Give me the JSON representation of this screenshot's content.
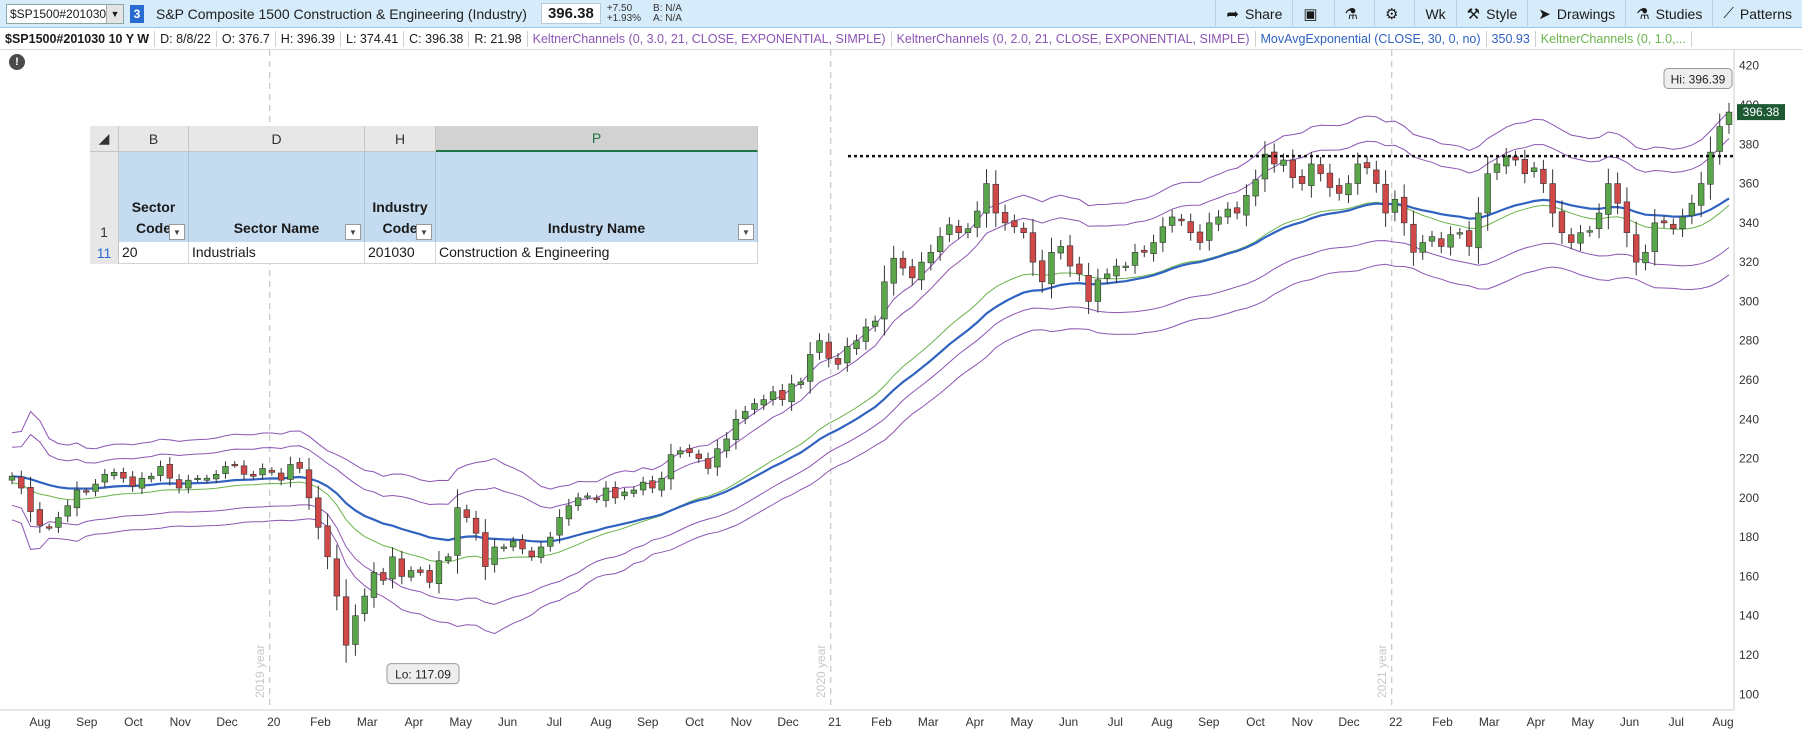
{
  "toolbar": {
    "symbol_input": "$SP1500#201030",
    "link_badge": "3",
    "security_name": "S&P Composite 1500 Construction & Engineering (Industry)",
    "last_price": "396.38",
    "change_abs": "+7.50",
    "change_pct": "+1.93%",
    "bid": "B: N/A",
    "ask": "A: N/A",
    "share_label": "Share",
    "aggregation_label": "Wk",
    "style_label": "Style",
    "drawings_label": "Drawings",
    "studies_label": "Studies",
    "patterns_label": "Patterns"
  },
  "study_bar": {
    "symbol_period": "$SP1500#201030 10 Y W",
    "date": "D: 8/8/22",
    "open": "O: 376.7",
    "high": "H: 396.39",
    "low": "L: 374.41",
    "close": "C: 396.38",
    "range": "R: 21.98",
    "study1": "KeltnerChannels (0, 3.0, 21, CLOSE, EXPONENTIAL, SIMPLE)",
    "study2": "KeltnerChannels (0, 2.0, 21, CLOSE, EXPONENTIAL, SIMPLE)",
    "study3": "MovAvgExponential (CLOSE, 30, 0, no)",
    "study3_value": "350.93",
    "study4": "KeltnerChannels (0, 1.0,...",
    "colors": {
      "purple": "#8c55b4",
      "blue": "#2f62c1",
      "green": "#6bb34b"
    }
  },
  "sheet": {
    "columns": [
      "B",
      "D",
      "H",
      "P"
    ],
    "header_row_num": "1",
    "headers": {
      "sector_code_1": "Sector",
      "sector_code_2": "Code",
      "sector_name": "Sector Name",
      "industry_code_1": "Industry",
      "industry_code_2": "Code",
      "industry_name": "Industry Name"
    },
    "data_row_num": "11",
    "row": {
      "sector_code": "20",
      "sector_name": "Industrials",
      "industry_code": "201030",
      "industry_name": "Construction & Engineering"
    }
  },
  "chart_data": {
    "type": "candlestick",
    "y_ticks": [
      100,
      120,
      140,
      160,
      180,
      200,
      220,
      240,
      260,
      280,
      300,
      320,
      340,
      360,
      380,
      400,
      420
    ],
    "ylim": [
      92,
      428
    ],
    "x_labels": [
      "Aug",
      "Sep",
      "Oct",
      "Nov",
      "Dec",
      "20",
      "Feb",
      "Mar",
      "Apr",
      "May",
      "Jun",
      "Jul",
      "Aug",
      "Sep",
      "Oct",
      "Nov",
      "Dec",
      "21",
      "Feb",
      "Mar",
      "Apr",
      "May",
      "Jun",
      "Jul",
      "Aug",
      "Sep",
      "Oct",
      "Nov",
      "Dec",
      "22",
      "Feb",
      "Mar",
      "Apr",
      "May",
      "Jun",
      "Jul",
      "Aug"
    ],
    "year_markers": [
      "2019 year",
      "2020 year",
      "2021 year"
    ],
    "hi_label": "Hi: 396.39",
    "lo_label": "Lo: 117.09",
    "last_price_tag": "396.38",
    "resistance_level": 374,
    "weekly_close": [
      211,
      205,
      193,
      186,
      185,
      190,
      196,
      204,
      203,
      207,
      212,
      213,
      210,
      206,
      210,
      211,
      216,
      210,
      205,
      209,
      210,
      210,
      212,
      216,
      217,
      212,
      211,
      215,
      213,
      209,
      217,
      215,
      200,
      185,
      170,
      150,
      125,
      140,
      150,
      162,
      158,
      170,
      160,
      163,
      162,
      157,
      168,
      170,
      195,
      190,
      182,
      165,
      175,
      175,
      178,
      174,
      170,
      175,
      180,
      190,
      196,
      200,
      201,
      199,
      205,
      200,
      203,
      204,
      208,
      205,
      210,
      222,
      224,
      223,
      220,
      215,
      225,
      230,
      240,
      244,
      248,
      250,
      254,
      250,
      258,
      259,
      273,
      280,
      271,
      268,
      277,
      280,
      287,
      290,
      310,
      322,
      317,
      312,
      320,
      325,
      333,
      339,
      335,
      337,
      346,
      360,
      345,
      340,
      338,
      335,
      320,
      310,
      325,
      328,
      318,
      314,
      300,
      311,
      314,
      318,
      318,
      325,
      325,
      330,
      338,
      343,
      341,
      335,
      330,
      340,
      343,
      347,
      345,
      354,
      362,
      375,
      370,
      372,
      363,
      360,
      370,
      365,
      358,
      355,
      360,
      370,
      368,
      360,
      345,
      352,
      340,
      325,
      330,
      333,
      328,
      334,
      335,
      328,
      345,
      365,
      370,
      374,
      372,
      365,
      368,
      360,
      345,
      335,
      330,
      335,
      336,
      345,
      360,
      350,
      335,
      320,
      325,
      340,
      340,
      337,
      343,
      350,
      360,
      376,
      389,
      396.38
    ],
    "series": [
      {
        "name": "MovAvgExponential (CLOSE, 30, 0, no)",
        "color": "#2f62c1"
      },
      {
        "name": "KeltnerChannels (0, 1.0, 21, CLOSE, EXPONENTIAL, SIMPLE)",
        "color": "#6bb34b"
      },
      {
        "name": "KeltnerChannels (0, 2.0, 21, CLOSE, EXPONENTIAL, SIMPLE)",
        "color": "#8c55b4"
      },
      {
        "name": "KeltnerChannels (0, 3.0, 21, CLOSE, EXPONENTIAL, SIMPLE)",
        "color": "#8c55b4"
      }
    ],
    "up_color": "#5aa64b",
    "down_color": "#d04848"
  }
}
